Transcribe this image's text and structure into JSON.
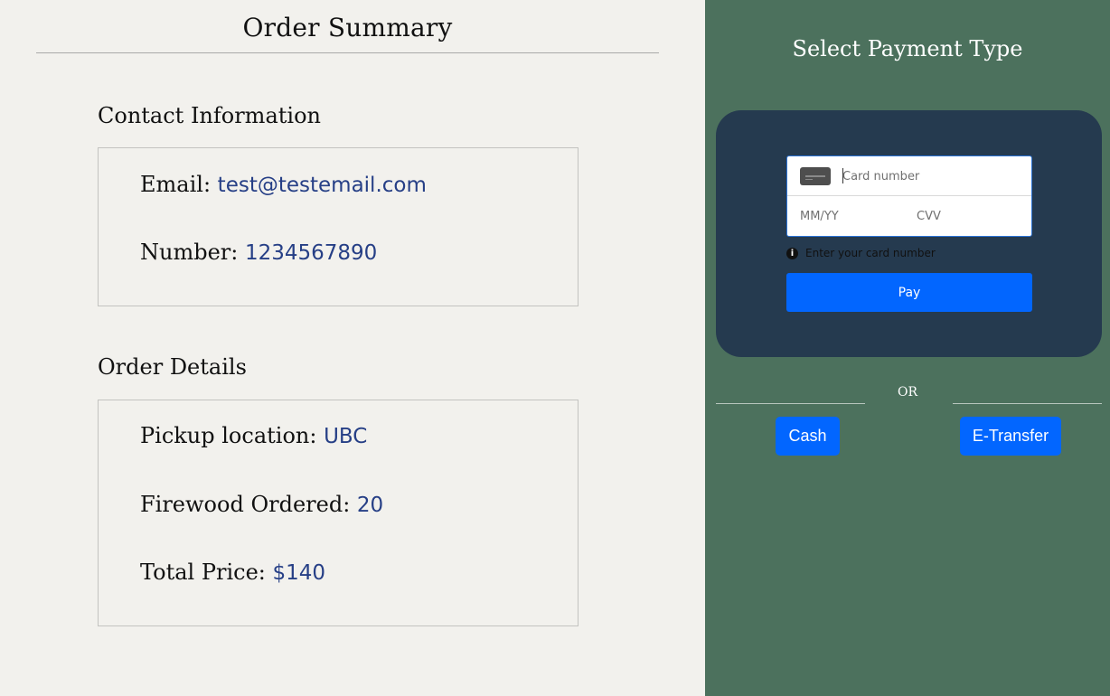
{
  "summary": {
    "title": "Order Summary",
    "contact": {
      "heading": "Contact Information",
      "email_label": "Email:",
      "email_value": "test@testemail.com",
      "number_label": "Number:",
      "number_value": "1234567890"
    },
    "order": {
      "heading": "Order Details",
      "pickup_label": "Pickup location:",
      "pickup_value": "UBC",
      "firewood_label": "Firewood Ordered:",
      "firewood_value": "20",
      "price_label": "Total Price:",
      "price_value": "$140"
    }
  },
  "payment": {
    "title": "Select Payment Type",
    "card_form": {
      "card_number_placeholder": "Card number",
      "expiry_placeholder": "MM/YY",
      "cvv_placeholder": "CVV",
      "hint_icon": "info-icon",
      "hint_text": "Enter your card number",
      "pay_label": "Pay"
    },
    "or_label": "OR",
    "cash_label": "Cash",
    "etransfer_label": "E-Transfer"
  },
  "colors": {
    "left_background": "#f2f1ed",
    "right_background": "#4c715d",
    "card_panel": "#253a4f",
    "accent_blue": "#0266ff",
    "value_text": "#263f86"
  }
}
